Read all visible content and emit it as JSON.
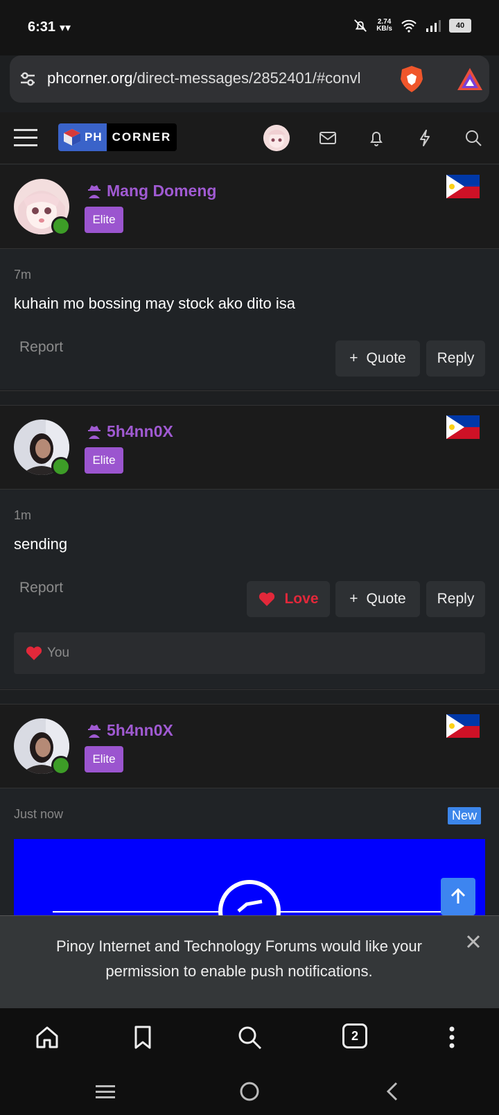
{
  "status_bar": {
    "time": "6:31",
    "net_speed_value": "2.74",
    "net_speed_unit": "KB/s",
    "battery": "40"
  },
  "browser": {
    "url_domain": "phcorner.org",
    "url_path": "/direct-messages/2852401/#convl"
  },
  "site_header": {
    "logo_ph": "PH",
    "logo_corner": "CORNER"
  },
  "posts": [
    {
      "username": "Mang Domeng",
      "badge": "Elite",
      "time": "7m",
      "text": "kuhain mo bossing may stock ako dito isa",
      "report": "Report",
      "quote": "Quote",
      "reply": "Reply"
    },
    {
      "username": "5h4nn0X",
      "badge": "Elite",
      "time": "1m",
      "text": "sending",
      "report": "Report",
      "love": "Love",
      "quote": "Quote",
      "reply": "Reply",
      "reaction_user": "You"
    },
    {
      "username": "5h4nn0X",
      "badge": "Elite",
      "time": "Just now",
      "new_label": "New"
    }
  ],
  "push_banner": {
    "text": "Pinoy Internet and Technology Forums would like your permission to enable push notifications."
  },
  "bottom_nav": {
    "tab_count": "2"
  },
  "colors": {
    "username_purple": "#a05ad2",
    "elite_badge": "#9b55cf",
    "love_red": "#e2283a",
    "new_badge_blue": "#3c86ea",
    "online_green": "#3d9d27"
  }
}
